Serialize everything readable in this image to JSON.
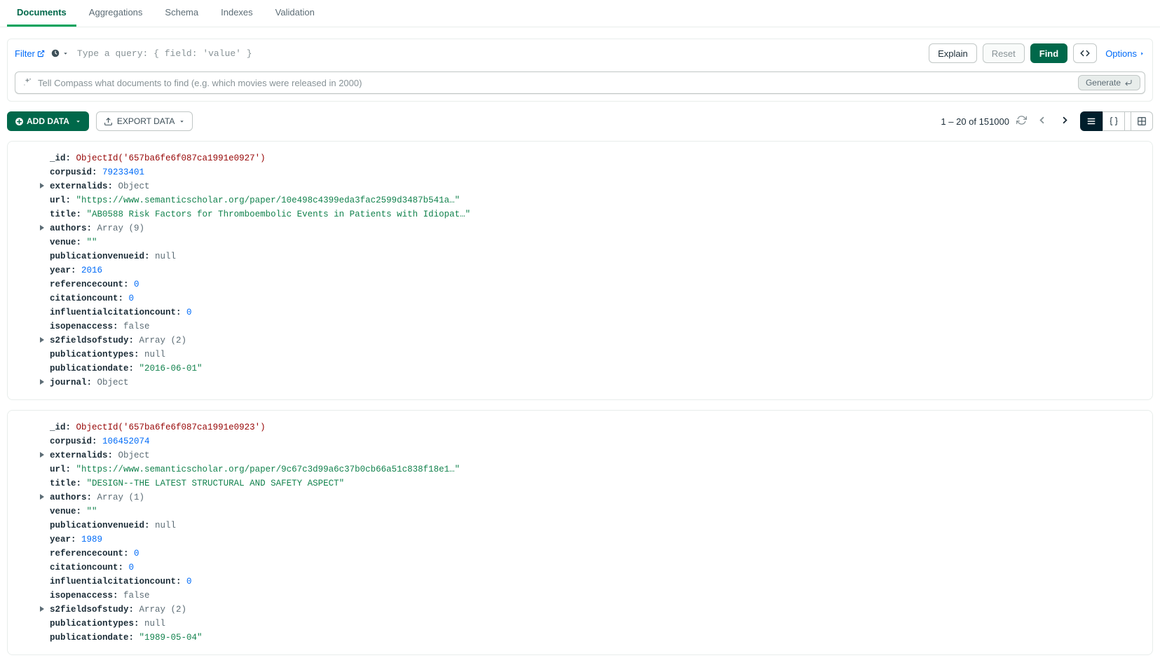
{
  "tabs": {
    "documents": "Documents",
    "aggregations": "Aggregations",
    "schema": "Schema",
    "indexes": "Indexes",
    "validation": "Validation"
  },
  "query": {
    "filter_label": "Filter",
    "placeholder": "Type a query: { field: 'value' }",
    "explain": "Explain",
    "reset": "Reset",
    "find": "Find",
    "options": "Options"
  },
  "ai": {
    "placeholder": "Tell Compass what documents to find (e.g. which movies were released in 2000)",
    "generate": "Generate"
  },
  "toolbar": {
    "add": "ADD DATA",
    "export": "EXPORT DATA",
    "paging": "1 – 20 of 151000"
  },
  "docs": [
    {
      "_id": "ObjectId('657ba6fe6f087ca1991e0927')",
      "corpusid": "79233401",
      "externalids": "Object",
      "url": "\"https://www.semanticscholar.org/paper/10e498c4399eda3fac2599d3487b541a…\"",
      "title": "\"AB0588 Risk Factors for Thromboembolic Events in Patients with Idiopat…\"",
      "authors": "Array (9)",
      "venue": "\"\"",
      "publicationvenueid": "null",
      "year": "2016",
      "referencecount": "0",
      "citationcount": "0",
      "influentialcitationcount": "0",
      "isopenaccess": "false",
      "s2fieldsofstudy": "Array (2)",
      "publicationtypes": "null",
      "publicationdate": "\"2016-06-01\"",
      "journal": "Object"
    },
    {
      "_id": "ObjectId('657ba6fe6f087ca1991e0923')",
      "corpusid": "106452074",
      "externalids": "Object",
      "url": "\"https://www.semanticscholar.org/paper/9c67c3d99a6c37b0cb66a51c838f18e1…\"",
      "title": "\"DESIGN--THE LATEST STRUCTURAL AND SAFETY ASPECT\"",
      "authors": "Array (1)",
      "venue": "\"\"",
      "publicationvenueid": "null",
      "year": "1989",
      "referencecount": "0",
      "citationcount": "0",
      "influentialcitationcount": "0",
      "isopenaccess": "false",
      "s2fieldsofstudy": "Array (2)",
      "publicationtypes": "null",
      "publicationdate": "\"1989-05-04\""
    }
  ]
}
